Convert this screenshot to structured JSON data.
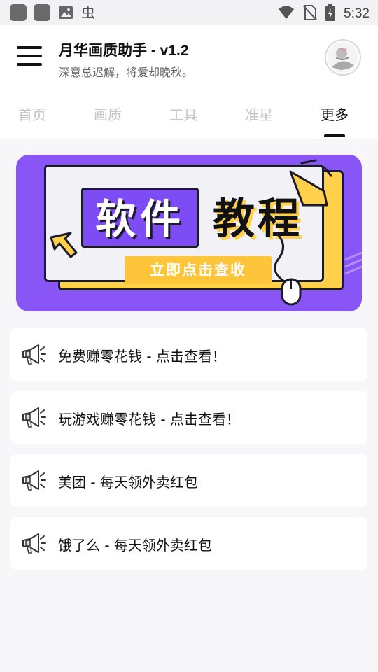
{
  "status_bar": {
    "time": "5:32",
    "bug_glyph": "虫"
  },
  "header": {
    "title": "月华画质助手 - v1.2",
    "subtitle": "深意总迟解，将爱却晚秋。"
  },
  "tabs": [
    {
      "label": "首页",
      "active": false
    },
    {
      "label": "画质",
      "active": false
    },
    {
      "label": "工具",
      "active": false
    },
    {
      "label": "准星",
      "active": false
    },
    {
      "label": "更多",
      "active": true
    }
  ],
  "banner": {
    "word_1": "软件",
    "word_2": "教程",
    "cta": "立即点击查收",
    "colors": {
      "background": "#8a55f7",
      "accent": "#ffd04a"
    }
  },
  "items": [
    {
      "text": "免费赚零花钱 - 点击查看！",
      "icon": "megaphone-icon"
    },
    {
      "text": "玩游戏赚零花钱 - 点击查看！",
      "icon": "megaphone-icon"
    },
    {
      "text": "美团 - 每天领外卖红包",
      "icon": "megaphone-icon"
    },
    {
      "text": "饿了么 - 每天领外卖红包",
      "icon": "megaphone-icon"
    }
  ]
}
